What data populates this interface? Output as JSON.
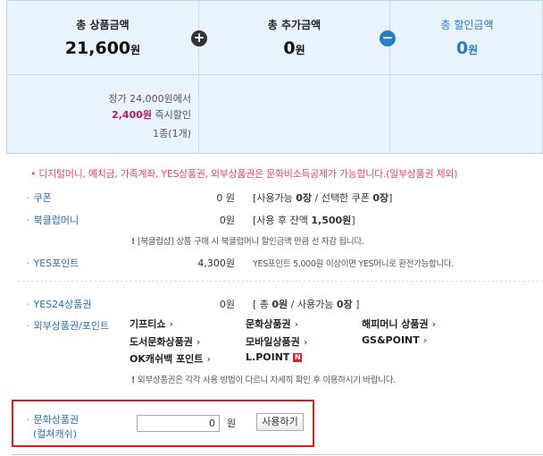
{
  "summary": {
    "total_product": {
      "title": "총 상품금액",
      "value": "21,600",
      "unit": "원"
    },
    "total_extra": {
      "title": "총 추가금액",
      "value": "0",
      "unit": "원"
    },
    "total_discount": {
      "title": "총 할인금액",
      "value": "0",
      "unit": "원"
    },
    "plus_symbol": "+",
    "minus_symbol": "−",
    "detail_price": "정가 24,000원에서",
    "detail_discount_amount": "2,400원",
    "detail_discount_text": " 즉시할인",
    "detail_count": "1종(1개)"
  },
  "notice": "• 디지털머니, 예치금, 가족계좌, YES상품권, 외부상품권은 문화비소득공제가 가능합니다.(일부상품권 제외)",
  "coupon": {
    "label": "쿠폰",
    "amount": "0 원",
    "info_prefix": "[사용가능 ",
    "available": "0장",
    "info_mid": " / 선택한 쿠폰 ",
    "selected": "0장",
    "info_suffix": "]"
  },
  "bookclub": {
    "label": "북클럽머니",
    "amount": "0원",
    "info_prefix": "[사용 후 잔액 ",
    "balance": "1,500원",
    "info_suffix": "]",
    "note_mark": "!",
    "note": "[북클럽샵] 상품 구매 시 북클럽머니 할인금액 만큼 선 차감 됩니다."
  },
  "yespoint": {
    "label": "YES포인트",
    "amount": "4,300원",
    "info": "YES포인트 5,000원 이상이면 YES머니로 환전가능합니다."
  },
  "yes24_voucher": {
    "label": "YES24상품권",
    "amount": "0원",
    "info_prefix": "[ 총 ",
    "total": "0원",
    "info_mid": " / 사용가능 ",
    "available": "0장",
    "info_suffix": " ]"
  },
  "external": {
    "label": "외부상품권/포인트",
    "arrow": "›",
    "items": [
      "기프티쇼",
      "문화상품권",
      "해피머니 상품권",
      "도서문화상품권",
      "모바일상품권",
      "GS&POINT",
      "OK캐쉬백 포인트",
      "L.POINT"
    ],
    "lpoint_badge": "N",
    "note_mark": "!",
    "note": "외부상품권은 각각 사용 방법이 다르니 자세히 확인 후 이용하시기 바랍니다."
  },
  "culture_voucher": {
    "label_line1": "문화상품권",
    "label_line2": "(컬쳐캐쉬)",
    "input_value": "0",
    "unit": "원",
    "button": "사용하기"
  }
}
